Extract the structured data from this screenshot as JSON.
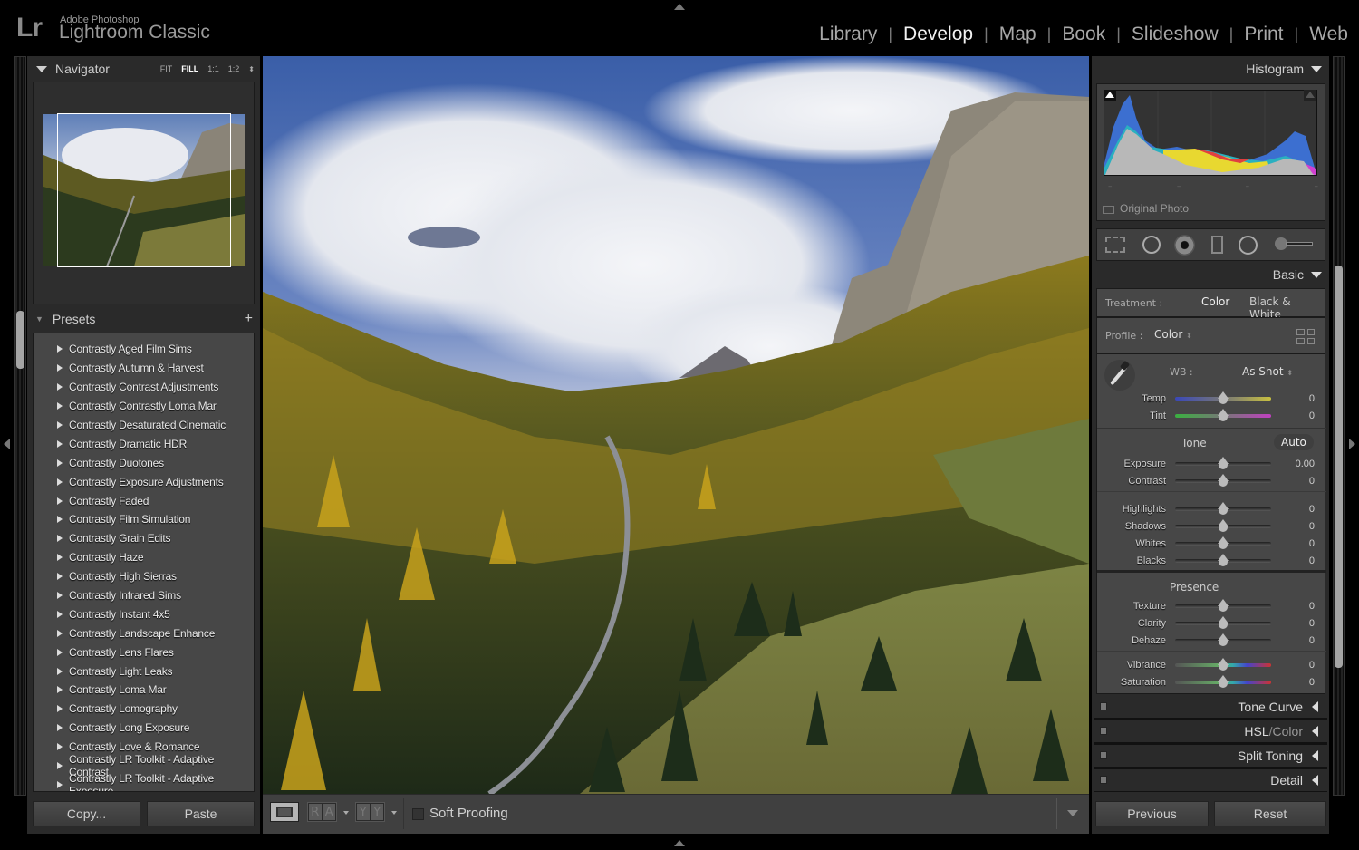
{
  "app": {
    "brand_short": "Lr",
    "brand_small": "Adobe Photoshop",
    "brand_name": "Lightroom Classic"
  },
  "modules": [
    {
      "label": "Library",
      "active": false
    },
    {
      "label": "Develop",
      "active": true
    },
    {
      "label": "Map",
      "active": false
    },
    {
      "label": "Book",
      "active": false
    },
    {
      "label": "Slideshow",
      "active": false
    },
    {
      "label": "Print",
      "active": false
    },
    {
      "label": "Web",
      "active": false
    }
  ],
  "navigator": {
    "title": "Navigator",
    "zoom_options": [
      "FIT",
      "FILL",
      "1:1",
      "1:2"
    ],
    "selected_zoom": "FILL"
  },
  "presets": {
    "title": "Presets",
    "add_icon": "plus-icon",
    "items": [
      "Contrastly Aged Film Sims",
      "Contrastly Autumn & Harvest",
      "Contrastly Contrast Adjustments",
      "Contrastly Contrastly Loma Mar",
      "Contrastly Desaturated Cinematic",
      "Contrastly Dramatic HDR",
      "Contrastly Duotones",
      "Contrastly Exposure Adjustments",
      "Contrastly Faded",
      "Contrastly Film Simulation",
      "Contrastly Grain Edits",
      "Contrastly Haze",
      "Contrastly High Sierras",
      "Contrastly Infrared Sims",
      "Contrastly Instant 4x5",
      "Contrastly Landscape Enhance",
      "Contrastly Lens Flares",
      "Contrastly Light Leaks",
      "Contrastly Loma Mar",
      "Contrastly Lomography",
      "Contrastly Long Exposure",
      "Contrastly Love & Romance",
      "Contrastly LR Toolkit - Adaptive Contrast",
      "Contrastly LR Toolkit - Adaptive Exposure"
    ]
  },
  "left_buttons": {
    "copy": "Copy...",
    "paste": "Paste"
  },
  "toolbar": {
    "soft_proofing_label": "Soft Proofing",
    "soft_proofing_checked": false,
    "before_after_labels": [
      "R",
      "A"
    ],
    "compare_labels": [
      "Y",
      "Y"
    ]
  },
  "histogram": {
    "title": "Histogram",
    "original_photo_label": "Original Photo",
    "original_photo_checked": false
  },
  "basic": {
    "title": "Basic",
    "treatment_label": "Treatment :",
    "treatment_options": [
      "Color",
      "Black & White"
    ],
    "treatment_selected": "Color",
    "profile_label": "Profile :",
    "profile_value": "Color",
    "wb_label": "WB :",
    "wb_value": "As Shot",
    "tone_label": "Tone",
    "auto_label": "Auto",
    "presence_label": "Presence",
    "wb_sliders": [
      {
        "label": "Temp",
        "value": "0",
        "position": 0.5
      },
      {
        "label": "Tint",
        "value": "0",
        "position": 0.5
      }
    ],
    "tone_sliders": [
      {
        "label": "Exposure",
        "value": "0.00",
        "position": 0.5
      },
      {
        "label": "Contrast",
        "value": "0",
        "position": 0.5
      }
    ],
    "tone_sliders2": [
      {
        "label": "Highlights",
        "value": "0",
        "position": 0.5
      },
      {
        "label": "Shadows",
        "value": "0",
        "position": 0.5
      },
      {
        "label": "Whites",
        "value": "0",
        "position": 0.5
      },
      {
        "label": "Blacks",
        "value": "0",
        "position": 0.5
      }
    ],
    "presence_sliders": [
      {
        "label": "Texture",
        "value": "0",
        "position": 0.5
      },
      {
        "label": "Clarity",
        "value": "0",
        "position": 0.5
      },
      {
        "label": "Dehaze",
        "value": "0",
        "position": 0.5
      }
    ],
    "presence_sliders2": [
      {
        "label": "Vibrance",
        "value": "0",
        "position": 0.5
      },
      {
        "label": "Saturation",
        "value": "0",
        "position": 0.5
      }
    ]
  },
  "collapsed_panels": [
    {
      "label": "Tone Curve"
    },
    {
      "label": "HSL",
      "label2": "/",
      "label3": "Color"
    },
    {
      "label": "Split Toning"
    },
    {
      "label": "Detail"
    }
  ],
  "right_buttons": {
    "previous": "Previous",
    "reset": "Reset"
  }
}
